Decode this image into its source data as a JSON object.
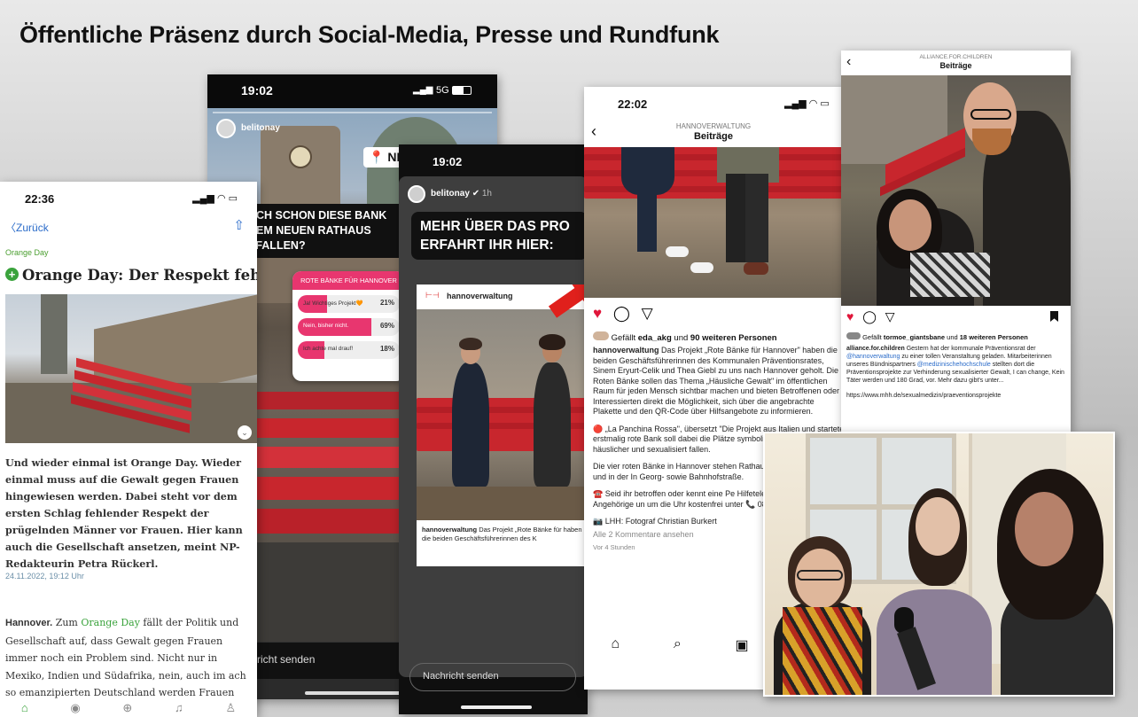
{
  "slide": {
    "title": "Öffentliche Präsenz durch Social-Media, Presse und Rundfunk"
  },
  "news_app": {
    "time": "22:36",
    "back_label": "Zurück",
    "category": "Orange Day",
    "headline": "Orange Day: Der Respekt fehlt",
    "lead": "Und wieder einmal ist Orange Day. Wieder einmal muss auf die Gewalt gegen Frauen hingewiesen werden. Dabei steht vor dem ersten Schlag fehlender Respekt der prügelnden Männer vor Frauen. Hier kann auch die Gesellschaft ansetzen, meint NP-Redakteurin Petra Rückerl.",
    "date": "24.11.2022, 19:12 Uhr",
    "body_lead": "Hannover.",
    "body_link": "Orange Day",
    "body_pre": "Zum",
    "body_rest": "fällt der Politik und Gesellschaft auf, dass Gewalt gegen Frauen immer noch ein Problem sind. Nicht nur in Mexiko, Indien und Südafrika, nein, auch im ach so emanzipierten Deutschland werden Frauen von ihren Männern"
  },
  "story1": {
    "time": "19:02",
    "network": "5G",
    "user": "belitonay",
    "sticker_text": "NEU",
    "question": "UCH SCHON DIESE BANK DEM NEUEN RATHAUS EFALLEN?",
    "poll_title": "ROTE BÄNKE FÜR HANNOVER",
    "poll_options": [
      {
        "label": "Ja! Wichtiges Projekt🧡",
        "percent": "21%",
        "share": 21
      },
      {
        "label": "Nein, bisher nicht.",
        "percent": "69%",
        "share": 69
      },
      {
        "label": "Ich achte mal drauf!",
        "percent": "18%",
        "share": 18
      }
    ],
    "message_placeholder": "richt senden"
  },
  "story2": {
    "time": "19:02",
    "user": "belitonay",
    "age": "1h",
    "caption": "MEHR ÜBER DAS PRO ERFAHRT IHR HIER:",
    "post_user": "hannoverwaltung",
    "post_caption_user": "hannoverwaltung",
    "post_caption": "Das Projekt „Rote Bänke für haben die beiden Geschäftsführerinnen des K",
    "message_placeholder": "Nachricht senden"
  },
  "instagram_post": {
    "time": "22:02",
    "header_account": "HANNOVERWALTUNG",
    "header_title": "Beiträge",
    "likes_prefix": "Gefällt",
    "likes_user": "eda_akg",
    "likes_suffix": "und",
    "likes_rest": "90 weiteren Personen",
    "caption_user": "hannoverwaltung",
    "caption_1": "Das Projekt „Rote Bänke für Hannover\" haben die beiden Geschäftsführerinnen des Kommunalen Präventionsrates, Sinem Eryurt-Celik und Thea Giebl zu uns nach Hannover geholt. Die Roten Bänke sollen das Thema „Häusliche Gewalt\" im öffentlichen Raum für jeden Mensch sichtbar machen und bieten Betroffenen oder Interessierten direkt die Möglichkeit, sich über die angebrachte Plakette und den QR-Code über Hilfsangebote zu informieren.",
    "caption_2": "🔴 „La Panchina Rossa\", übersetzt \"Die Projekt aus Italien und startete erstmalig rote Bank soll dabei die Plätze symbolisi wenn Frauen häuslicher und sexualisiert fallen.",
    "caption_3": "Die vier roten Bänke in Hannover stehen Rathaus, vor der Markthalle und in der In Georg- sowie Bahnhofstraße.",
    "caption_4": "☎️ Seid ihr betroffen oder kennt eine Pe Hilfetelefon berät Frauen, Angehörige un um die Uhr kostenfrei unter 📞 0800 116",
    "photo_credit": "📷 LHH: Fotograf Christian Burkert",
    "comments": "Alle 2 Kommentare ansehen",
    "time_ago": "Vor 4 Stunden"
  },
  "alliance_post": {
    "header_account": "ALLIANCE.FOR.CHILDREN",
    "header_title": "Beiträge",
    "likes_prefix": "Gefällt",
    "likes_user": "tormoe_giantsbane",
    "likes_suffix": "und",
    "likes_rest": "18 weiteren Personen",
    "caption_user": "alliance.for.children",
    "caption_a": "Gestern hat der kommunale Präventionsrat der",
    "caption_mention1": "@hannoverwaltung",
    "caption_b": "zu einer tollen Veranstaltung geladen. Mitarbeiterinnen unseres Bündnispartners",
    "caption_mention2": "@medizinischehochschule",
    "caption_c": "stellten dort die Präventionsprojekte zur Verhinderung sexualisierter Gewalt, I can change, Kein Täter werden und 180 Grad, vor. Mehr dazu gibt's unter...",
    "link": "https://www.mhh.de/sexualmedizin/praeventionsprojekte"
  },
  "colors": {
    "bench_red": "#c8262d",
    "instagram_heart": "#e0163a",
    "news_green": "#3aa33c",
    "link_blue": "#2a6bc9"
  }
}
